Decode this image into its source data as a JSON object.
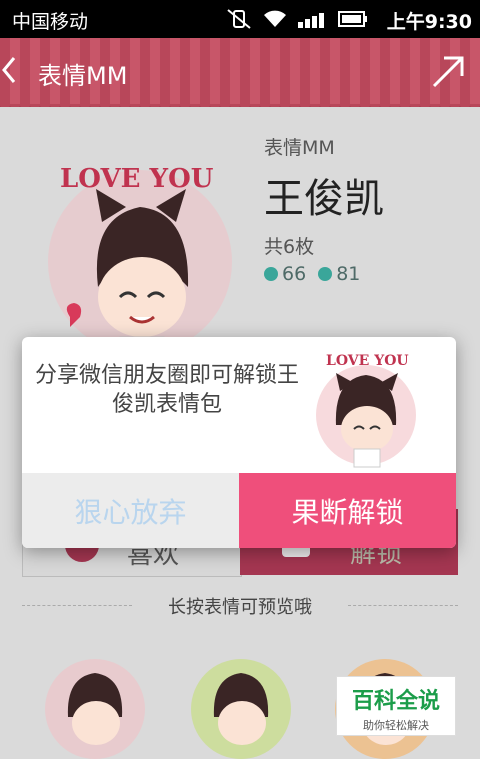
{
  "status_bar": {
    "carrier": "中国移动",
    "time": "上午9:30"
  },
  "header": {
    "title": "表情MM"
  },
  "pack": {
    "category": "表情MM",
    "name": "王俊凯",
    "count": "共6枚",
    "likes": "66",
    "downloads": "81",
    "sticker_caption": "LOVE YOU"
  },
  "actions": {
    "like_label": "喜欢",
    "unlock_label": "解锁"
  },
  "hint": "长按表情可预览哦",
  "dialog": {
    "message": "分享微信朋友圈即可解锁王俊凯表情包",
    "cancel_label": "狠心放弃",
    "confirm_label": "果断解锁"
  },
  "watermark": {
    "title": "百科全说",
    "subtitle": "助你轻松解决"
  },
  "colors": {
    "accent": "#ef4f7b",
    "header": "#b8475a",
    "cancel_text": "#b9d5ee"
  }
}
